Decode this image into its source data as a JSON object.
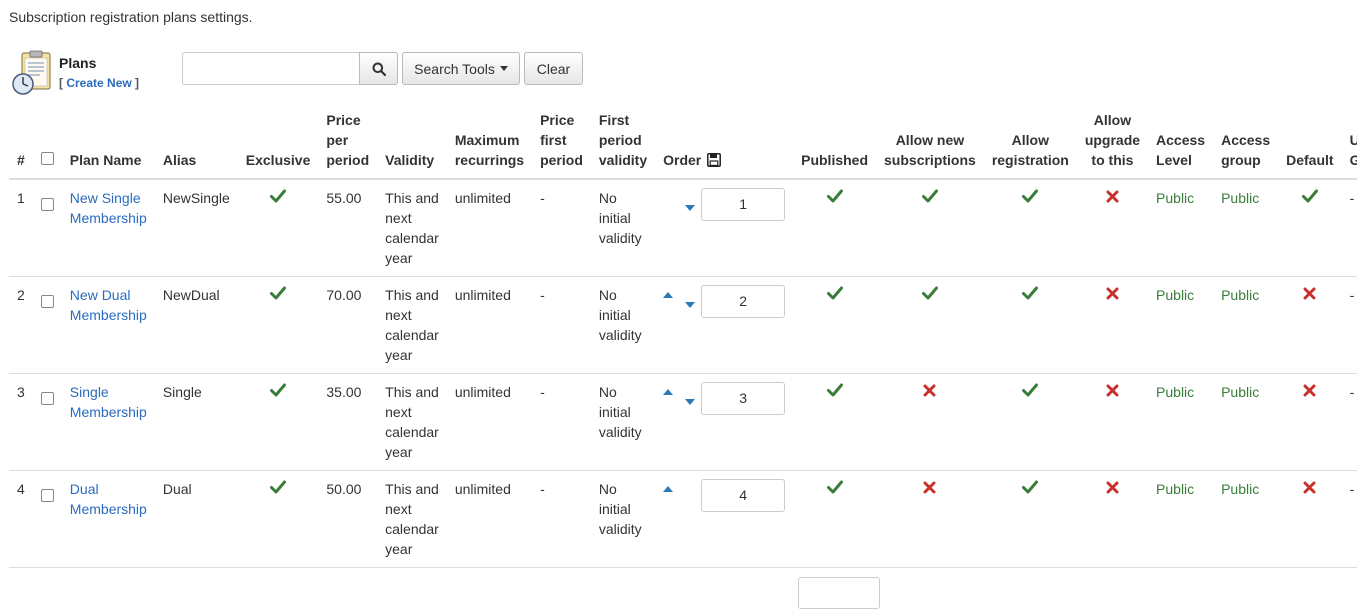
{
  "page": {
    "description": "Subscription registration plans settings."
  },
  "toolbar": {
    "title": "Plans",
    "create_prefix": "[ ",
    "create_label": "Create New",
    "create_suffix": " ]",
    "search_value": "",
    "search_placeholder": "",
    "search_tools_label": "Search Tools",
    "clear_label": "Clear"
  },
  "table": {
    "columns": {
      "num": "#",
      "plan_name": "Plan Name",
      "alias": "Alias",
      "exclusive": "Exclusive",
      "price_per_period": "Price per period",
      "validity": "Validity",
      "max_recurrings": "Maximum recurrings",
      "price_first": "Price first period",
      "first_validity": "First period validity",
      "order": "Order",
      "published": "Published",
      "allow_new": "Allow new subscriptions",
      "allow_registration": "Allow registration",
      "allow_upgrade": "Allow upgrade to this",
      "access_level": "Access Level",
      "access_group": "Access group",
      "default": "Default",
      "cut": "U G"
    },
    "rows": [
      {
        "num": "1",
        "plan_name": "New Single Membership",
        "alias": "NewSingle",
        "exclusive": true,
        "price": "55.00",
        "validity": "This and next calendar year",
        "max_recurrings": "unlimited",
        "price_first": "-",
        "first_validity": "No initial validity",
        "order": "1",
        "order_up": false,
        "order_down": true,
        "published": true,
        "allow_new": true,
        "allow_registration": true,
        "allow_upgrade": false,
        "access_level": "Public",
        "access_group": "Public",
        "default": true,
        "cut": "-"
      },
      {
        "num": "2",
        "plan_name": "New Dual Membership",
        "alias": "NewDual",
        "exclusive": true,
        "price": "70.00",
        "validity": "This and next calendar year",
        "max_recurrings": "unlimited",
        "price_first": "-",
        "first_validity": "No initial validity",
        "order": "2",
        "order_up": true,
        "order_down": true,
        "published": true,
        "allow_new": true,
        "allow_registration": true,
        "allow_upgrade": false,
        "access_level": "Public",
        "access_group": "Public",
        "default": false,
        "cut": "-"
      },
      {
        "num": "3",
        "plan_name": "Single Membership",
        "alias": "Single",
        "exclusive": true,
        "price": "35.00",
        "validity": "This and next calendar year",
        "max_recurrings": "unlimited",
        "price_first": "-",
        "first_validity": "No initial validity",
        "order": "3",
        "order_up": true,
        "order_down": true,
        "published": true,
        "allow_new": false,
        "allow_registration": true,
        "allow_upgrade": false,
        "access_level": "Public",
        "access_group": "Public",
        "default": false,
        "cut": "-"
      },
      {
        "num": "4",
        "plan_name": "Dual Membership",
        "alias": "Dual",
        "exclusive": true,
        "price": "50.00",
        "validity": "This and next calendar year",
        "max_recurrings": "unlimited",
        "price_first": "-",
        "first_validity": "No initial validity",
        "order": "4",
        "order_up": true,
        "order_down": false,
        "published": true,
        "allow_new": false,
        "allow_registration": true,
        "allow_upgrade": false,
        "access_level": "Public",
        "access_group": "Public",
        "default": false,
        "cut": "-"
      }
    ]
  },
  "colors": {
    "check": "#3a7d3a",
    "cross": "#c9302c",
    "link": "#2a6bbf",
    "green_text": "#3a7d3a",
    "order_arrow": "#2a7ab8"
  },
  "icons": {
    "plans": "clipboard-clock-icon",
    "search": "search-icon",
    "save_order": "floppy-disk-icon",
    "yes": "check-icon",
    "no": "cross-icon"
  }
}
